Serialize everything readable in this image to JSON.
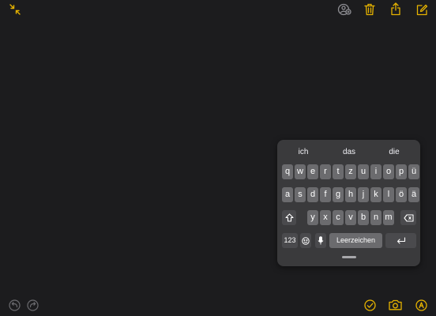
{
  "toolbar": {
    "collapse_icon": "arrows-collapse-icon",
    "collaborate_icon": "person-add-icon",
    "trash_icon": "trash-icon",
    "share_icon": "share-icon",
    "compose_icon": "compose-icon"
  },
  "keyboard": {
    "suggestions": [
      "ich",
      "das",
      "die"
    ],
    "row1": [
      "q",
      "w",
      "e",
      "r",
      "t",
      "z",
      "u",
      "i",
      "o",
      "p",
      "ü"
    ],
    "row2": [
      "a",
      "s",
      "d",
      "f",
      "g",
      "h",
      "j",
      "k",
      "l",
      "ö",
      "ä"
    ],
    "row3": [
      "y",
      "x",
      "c",
      "v",
      "b",
      "n",
      "m"
    ],
    "numbers_key": "123",
    "space_label": "Leerzeichen"
  },
  "bottom_bar": {
    "undo_icon": "undo-icon",
    "redo_icon": "redo-icon",
    "checklist_icon": "checkmark-circle-icon",
    "camera_icon": "camera-icon",
    "markup_icon": "markup-pen-icon"
  },
  "colors": {
    "accent": "#e6b300",
    "background": "#1c1c1e",
    "keyboard_bg": "#3a3a3c",
    "key_bg": "#6b6b6e"
  }
}
